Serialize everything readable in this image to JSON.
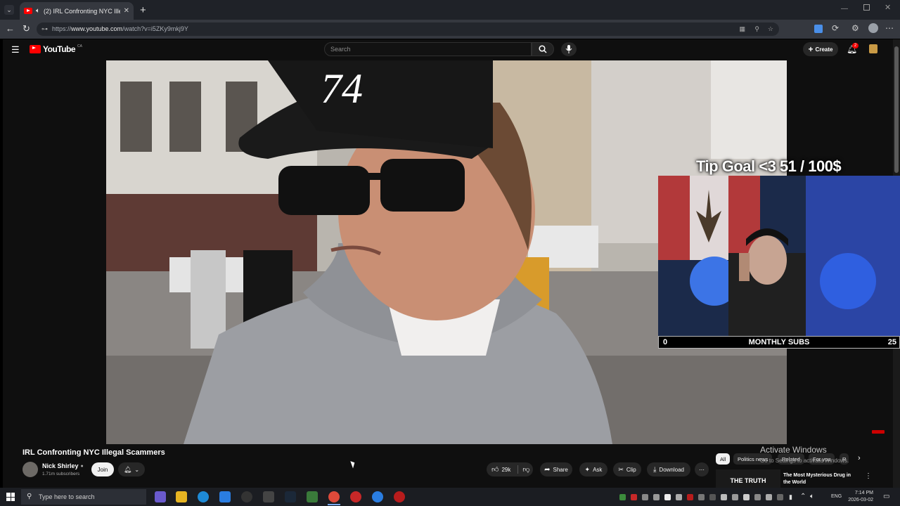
{
  "browser": {
    "tab_title": "(2) IRL Confronting NYC Illeg",
    "url_prefix": "https://",
    "url_host": "www.youtube.com",
    "url_path": "/watch?v=i5ZKy9mkj9Y"
  },
  "youtube": {
    "logo_text": "YouTube",
    "country_code": "CA",
    "search_placeholder": "Search",
    "create_label": "Create",
    "notification_count": "2"
  },
  "video": {
    "cap_text": "74",
    "overlay_tip_goal": "Tip Goal <3 51 / 100$",
    "subs_min": "0",
    "subs_label": "MONTHLY SUBS",
    "subs_max": "25",
    "title": "IRL Confronting NYC Illegal Scammers"
  },
  "channel": {
    "name": "Nick Shirley",
    "subscribers": "1.71m subscribers",
    "join_label": "Join"
  },
  "actions": {
    "likes": "29k",
    "share": "Share",
    "ask": "Ask",
    "clip": "Clip",
    "download": "Download"
  },
  "chips": [
    "All",
    "Politics news",
    "Related",
    "For you",
    "R"
  ],
  "recommendation": {
    "thumb_text": "THE TRUTH",
    "title_line1": "The Most Mysterious Drug in",
    "title_line2": "the World"
  },
  "watermark": {
    "line1": "Activate Windows",
    "line2": "Go to Settings to activate Windows."
  },
  "taskbar": {
    "search_placeholder": "Type here to search",
    "lang": "ENG",
    "time": "7:14 PM",
    "date": "2026-03-02"
  }
}
